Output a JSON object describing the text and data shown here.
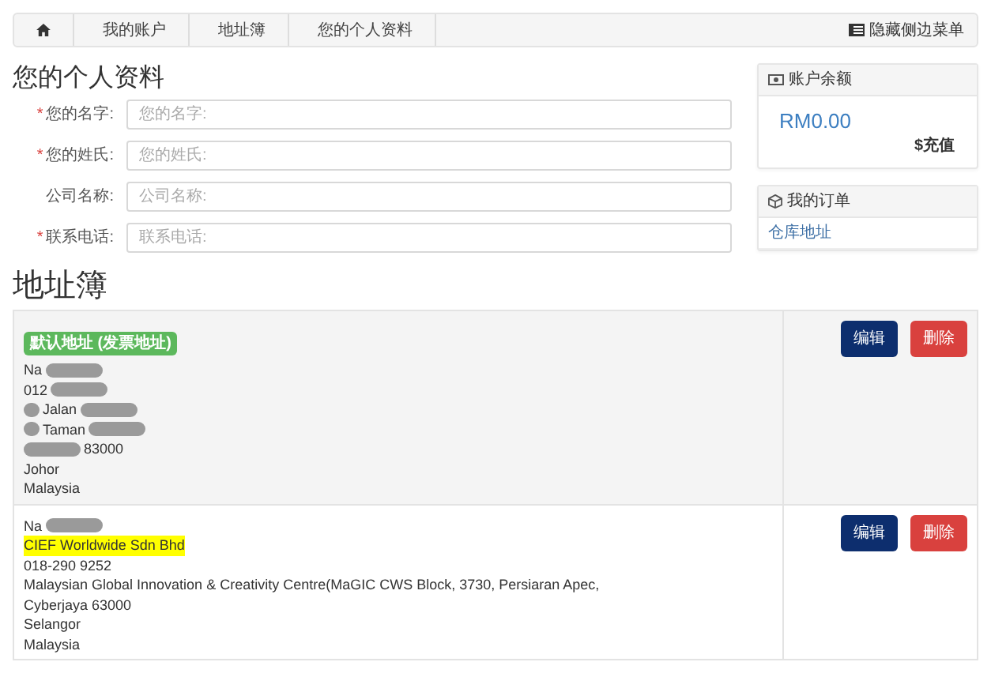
{
  "breadcrumb": {
    "items": [
      {
        "kind": "home"
      },
      {
        "kind": "text",
        "label": "我的账户"
      },
      {
        "kind": "text",
        "label": "地址簿"
      },
      {
        "kind": "text",
        "label": "您的个人资料"
      }
    ],
    "toggle_label": "隐藏侧边菜单"
  },
  "profile": {
    "title": "您的个人资料",
    "required_mark": "*",
    "fields": [
      {
        "label": "您的名字:",
        "placeholder": "您的名字:",
        "required": true
      },
      {
        "label": "您的姓氏:",
        "placeholder": "您的姓氏:",
        "required": true
      },
      {
        "label": "公司名称:",
        "placeholder": "公司名称:",
        "required": false
      },
      {
        "label": "联系电话:",
        "placeholder": "联系电话:",
        "required": true
      }
    ]
  },
  "sidebar": {
    "balance": {
      "title": "账户余额",
      "amount": "RM0.00",
      "topup": "$充值"
    },
    "orders": {
      "title": "我的订单",
      "items": [
        "仓库地址"
      ]
    }
  },
  "address_book": {
    "title": "地址簿",
    "addresses": [
      {
        "default": true,
        "badge": "默认地址 (发票地址)",
        "edit": "编辑",
        "delete": "删除",
        "lines": [
          {
            "highlight": false,
            "segments": [
              {
                "kind": "text",
                "text": "Na"
              },
              {
                "kind": "redacted"
              }
            ]
          },
          {
            "highlight": false,
            "segments": [
              {
                "kind": "text",
                "text": "012"
              },
              {
                "kind": "redacted"
              }
            ]
          },
          {
            "highlight": false,
            "segments": [
              {
                "kind": "redacted"
              },
              {
                "kind": "text",
                "text": "Jalan"
              },
              {
                "kind": "redacted"
              }
            ]
          },
          {
            "highlight": false,
            "segments": [
              {
                "kind": "redacted"
              },
              {
                "kind": "text",
                "text": "Taman"
              },
              {
                "kind": "redacted"
              }
            ]
          },
          {
            "highlight": false,
            "segments": [
              {
                "kind": "redacted"
              },
              {
                "kind": "text",
                "text": "83000"
              }
            ]
          },
          {
            "highlight": false,
            "segments": [
              {
                "kind": "text",
                "text": "Johor"
              }
            ]
          },
          {
            "highlight": false,
            "segments": [
              {
                "kind": "text",
                "text": "Malaysia"
              }
            ]
          }
        ]
      },
      {
        "default": false,
        "edit": "编辑",
        "delete": "删除",
        "lines": [
          {
            "highlight": false,
            "segments": [
              {
                "kind": "text",
                "text": "Na"
              },
              {
                "kind": "redacted"
              }
            ]
          },
          {
            "highlight": true,
            "segments": [
              {
                "kind": "text",
                "text": "CIEF Worldwide Sdn Bhd"
              }
            ]
          },
          {
            "highlight": false,
            "segments": [
              {
                "kind": "text",
                "text": "018-290 9252"
              }
            ]
          },
          {
            "highlight": false,
            "segments": [
              {
                "kind": "text",
                "text": "Malaysian Global Innovation & Creativity Centre(MaGIC CWS Block, 3730, Persiaran Apec,"
              }
            ]
          },
          {
            "highlight": false,
            "segments": [
              {
                "kind": "text",
                "text": "Cyberjaya 63000"
              }
            ]
          },
          {
            "highlight": false,
            "segments": [
              {
                "kind": "text",
                "text": "Selangor"
              }
            ]
          },
          {
            "highlight": false,
            "segments": [
              {
                "kind": "text",
                "text": "Malaysia"
              }
            ]
          }
        ]
      }
    ]
  }
}
